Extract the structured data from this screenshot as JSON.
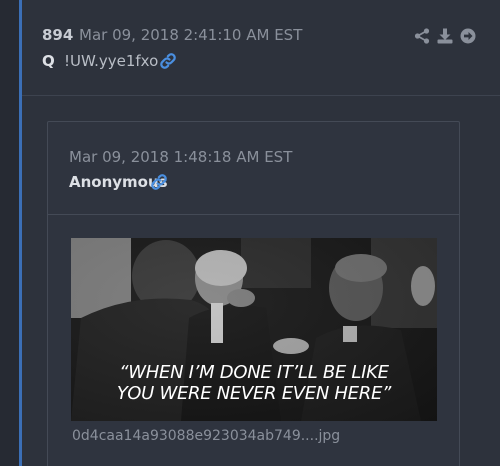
{
  "post": {
    "number": "894",
    "date": "Mar 09, 2018 2:41:10 AM EST",
    "author": "Q",
    "tripcode": "!UW.yye1fxo",
    "actions": [
      {
        "icon": "share-icon"
      },
      {
        "icon": "download-icon"
      },
      {
        "icon": "arrow-right-circle-icon"
      }
    ]
  },
  "quote": {
    "date": "Mar 09, 2018 1:48:18 AM EST",
    "author": "Anonymous",
    "image": {
      "caption_line1": "“WHEN I’M DONE IT’LL BE LIKE",
      "caption_line2": "YOU WERE NEVER EVEN HERE”",
      "filename": "0d4caa14a93088e923034ab749....jpg"
    }
  },
  "colors": {
    "background": "#262a33",
    "post_bg": "#2d323c",
    "accent_bar": "#3b6fb6",
    "link_icon": "#4a8fe0",
    "muted_text": "#8a909b"
  }
}
